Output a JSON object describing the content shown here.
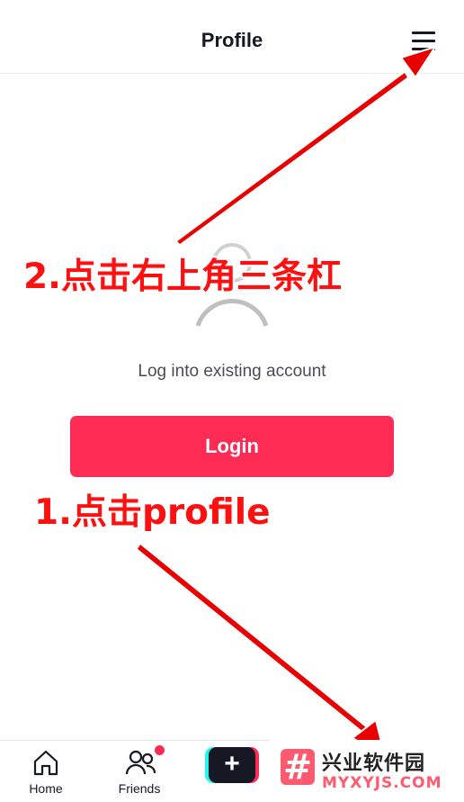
{
  "header": {
    "title": "Profile",
    "menu_icon": "hamburger-menu-icon"
  },
  "main": {
    "avatar_icon": "user-avatar-icon",
    "prompt": "Log into existing account",
    "login_label": "Login"
  },
  "annotations": {
    "step2": "2.点击右上角三条杠",
    "step1": "1.点击profile",
    "color": "#ff1010"
  },
  "tabbar": {
    "items": [
      {
        "label": "Home",
        "icon": "home-icon"
      },
      {
        "label": "Friends",
        "icon": "friends-icon"
      }
    ],
    "create_label": "+",
    "create_icon": "plus-icon"
  },
  "watermark": {
    "title": "兴业软件园",
    "subtitle": "MYXYJS.COM"
  },
  "colors": {
    "accent": "#fe2c55",
    "text": "#161823",
    "cyan": "#25f4ee"
  }
}
